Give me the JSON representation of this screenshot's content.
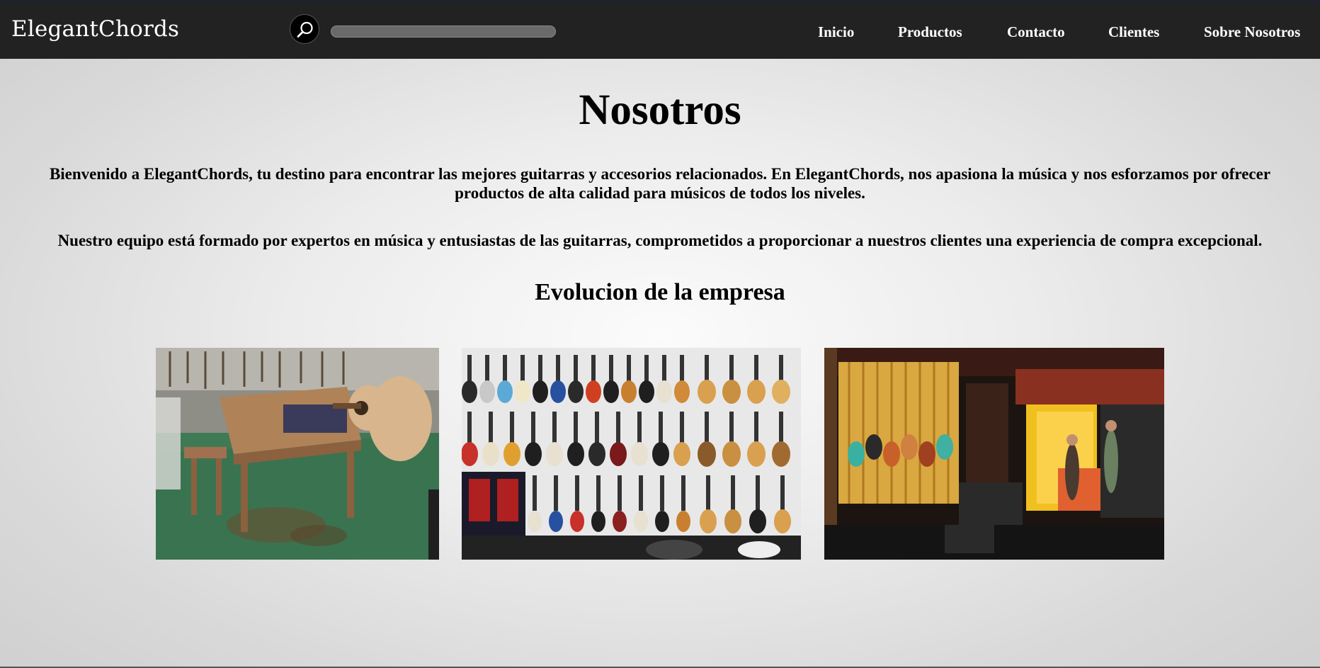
{
  "header": {
    "brand": "ElegantChords",
    "search": {
      "placeholder": "",
      "value": ""
    },
    "nav": [
      "Inicio",
      "Productos",
      "Contacto",
      "Clientes",
      "Sobre Nosotros"
    ]
  },
  "main": {
    "title": "Nosotros",
    "paragraph1": "Bienvenido a ElegantChords, tu destino para encontrar las mejores guitarras y accesorios relacionados. En ElegantChords, nos apasiona la música y nos esforzamos por ofrecer productos de alta calidad para músicos de todos los niveles.",
    "paragraph2": "Nuestro equipo está formado por expertos en música y entusiastas de las guitarras, comprometidos a proporcionar a nuestros clientes una experiencia de compra excepcional.",
    "section_title": "Evolucion de la empresa"
  },
  "colors": {
    "header_bg": "#222222",
    "text": "#000000",
    "nav_text": "#ffffff"
  },
  "icons": [
    "search-icon"
  ]
}
